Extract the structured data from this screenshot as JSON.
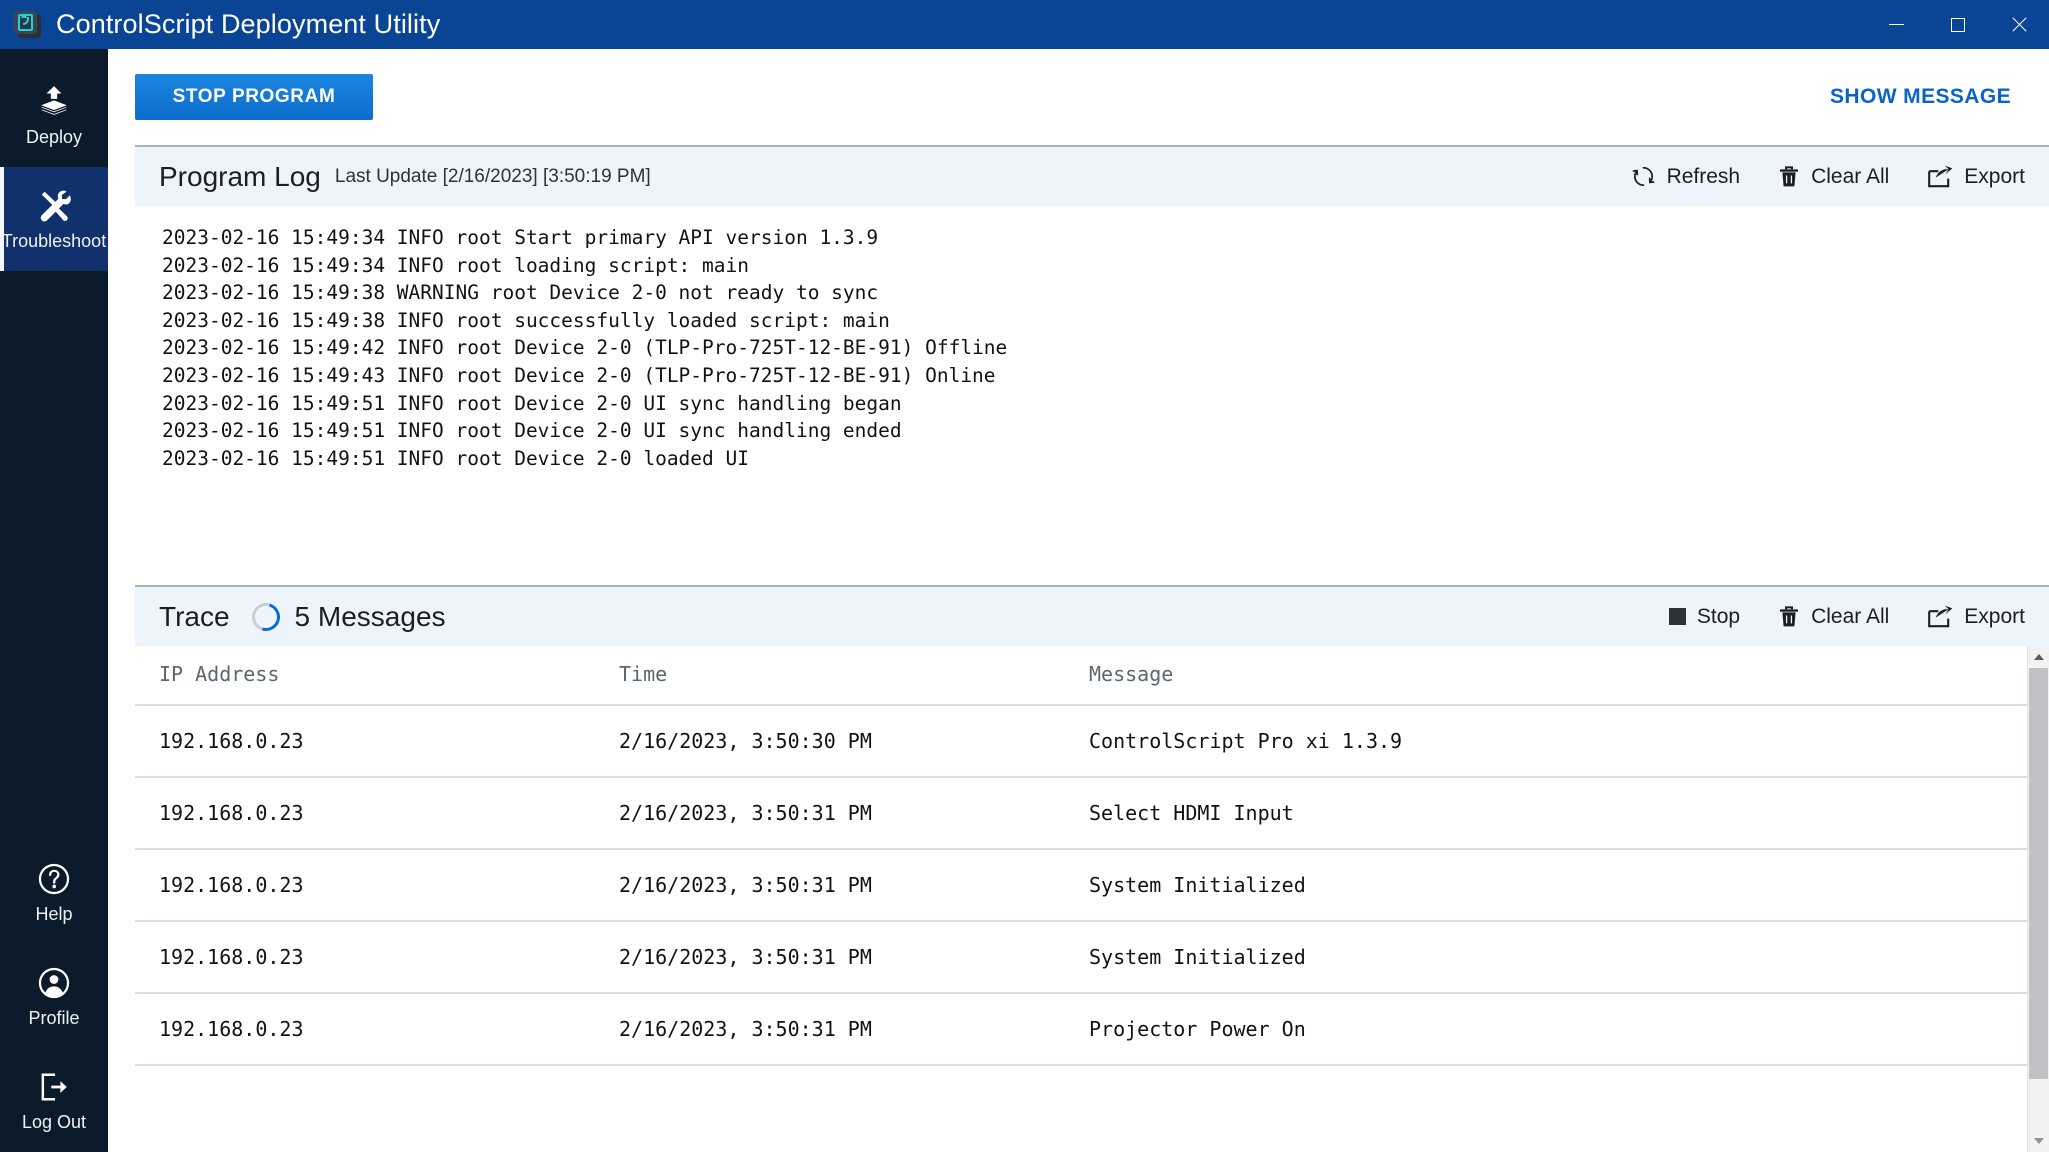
{
  "window": {
    "title": "ControlScript Deployment Utility",
    "icon": "app-logo-icon",
    "controls": {
      "minimize": "minimize-icon",
      "maximize": "maximize-icon",
      "close": "close-icon"
    },
    "titlebar_color": "#0a4595"
  },
  "sidebar": {
    "background_color": "#0b1b2b",
    "active_background_color": "#10316b",
    "items": [
      {
        "id": "deploy",
        "label": "Deploy",
        "icon": "layers-upload-icon",
        "active": false
      },
      {
        "id": "troubleshoot",
        "label": "Troubleshoot",
        "icon": "wrench-screwdriver-icon",
        "active": true
      }
    ],
    "bottom_items": [
      {
        "id": "help",
        "label": "Help",
        "icon": "question-circle-icon",
        "active": false
      },
      {
        "id": "profile",
        "label": "Profile",
        "icon": "user-circle-icon",
        "active": false
      },
      {
        "id": "logout",
        "label": "Log Out",
        "icon": "sign-out-icon",
        "active": false
      }
    ]
  },
  "toolbar": {
    "stop_program_label": "STOP PROGRAM",
    "show_message_label": "SHOW MESSAGE",
    "accent_color": "#0f6ccc",
    "link_color": "#0a63c8"
  },
  "program_log": {
    "title": "Program Log",
    "last_update": "Last Update [2/16/2023] [3:50:19 PM]",
    "actions": [
      {
        "id": "refresh",
        "label": "Refresh",
        "icon": "refresh-icon"
      },
      {
        "id": "clear-all",
        "label": "Clear All",
        "icon": "trash-icon"
      },
      {
        "id": "export",
        "label": "Export",
        "icon": "export-icon"
      }
    ],
    "lines": [
      "2023-02-16 15:49:34 INFO root Start primary API version 1.3.9",
      "2023-02-16 15:49:34 INFO root loading script: main",
      "2023-02-16 15:49:38 WARNING root Device 2-0 not ready to sync",
      "2023-02-16 15:49:38 INFO root successfully loaded script: main",
      "2023-02-16 15:49:42 INFO root Device 2-0 (TLP-Pro-725T-12-BE-91) Offline",
      "2023-02-16 15:49:43 INFO root Device 2-0 (TLP-Pro-725T-12-BE-91) Online",
      "2023-02-16 15:49:51 INFO root Device 2-0 UI sync handling began",
      "2023-02-16 15:49:51 INFO root Device 2-0 UI sync handling ended",
      "2023-02-16 15:49:51 INFO root Device 2-0 loaded UI"
    ]
  },
  "trace": {
    "title": "Trace",
    "spinner": "loading-spinner-icon",
    "message_count_label": "5 Messages",
    "actions": [
      {
        "id": "stop",
        "label": "Stop",
        "icon": "stop-square-icon"
      },
      {
        "id": "clear-all",
        "label": "Clear All",
        "icon": "trash-icon"
      },
      {
        "id": "export",
        "label": "Export",
        "icon": "export-icon"
      }
    ],
    "columns": [
      "IP Address",
      "Time",
      "Message"
    ],
    "rows": [
      {
        "ip": "192.168.0.23",
        "time": "2/16/2023, 3:50:30 PM",
        "message": "ControlScript Pro xi 1.3.9"
      },
      {
        "ip": "192.168.0.23",
        "time": "2/16/2023, 3:50:31 PM",
        "message": "Select HDMI Input"
      },
      {
        "ip": "192.168.0.23",
        "time": "2/16/2023, 3:50:31 PM",
        "message": "System Initialized"
      },
      {
        "ip": "192.168.0.23",
        "time": "2/16/2023, 3:50:31 PM",
        "message": "System Initialized"
      },
      {
        "ip": "192.168.0.23",
        "time": "2/16/2023, 3:50:31 PM",
        "message": "Projector Power On"
      }
    ],
    "scrollbar": {
      "up_arrow": "scroll-up-icon",
      "down_arrow": "scroll-down-icon"
    }
  }
}
